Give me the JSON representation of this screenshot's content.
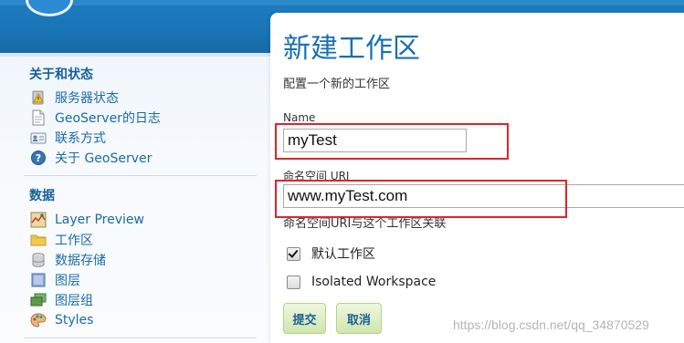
{
  "sidebar": {
    "sections": [
      {
        "title": "关于和状态",
        "items": [
          {
            "label": "服务器状态",
            "icon": "server-status-icon"
          },
          {
            "label": "GeoServer的日志",
            "icon": "document-log-icon"
          },
          {
            "label": "联系方式",
            "icon": "contact-card-icon"
          },
          {
            "label": "关于 GeoServer",
            "icon": "help-question-icon"
          }
        ]
      },
      {
        "title": "数据",
        "items": [
          {
            "label": "Layer Preview",
            "icon": "map-preview-icon"
          },
          {
            "label": "工作区",
            "icon": "folder-icon"
          },
          {
            "label": "数据存储",
            "icon": "database-icon"
          },
          {
            "label": "图层",
            "icon": "layer-icon"
          },
          {
            "label": "图层组",
            "icon": "layer-group-icon"
          },
          {
            "label": "Styles",
            "icon": "palette-icon"
          }
        ]
      }
    ]
  },
  "main": {
    "title": "新建工作区",
    "subtitle": "配置一个新的工作区",
    "name_label": "Name",
    "name_value": "myTest",
    "uri_label": "命名空间 URI",
    "uri_value": "www.myTest.com",
    "uri_hint": "命名空间URI与这个工作区关联",
    "default_checkbox": {
      "label": "默认工作区",
      "checked": true
    },
    "isolated_checkbox": {
      "label": "Isolated Workspace",
      "checked": false
    },
    "submit_label": "提交",
    "cancel_label": "取消"
  },
  "watermark": "https://blog.csdn.net/qq_34870529",
  "colors": {
    "header_blue": "#1a74b6",
    "link_blue": "#1b6aa8",
    "title_blue": "#1a6fb2",
    "highlight_red": "#e0242a",
    "button_green": "#cfe6ac"
  }
}
